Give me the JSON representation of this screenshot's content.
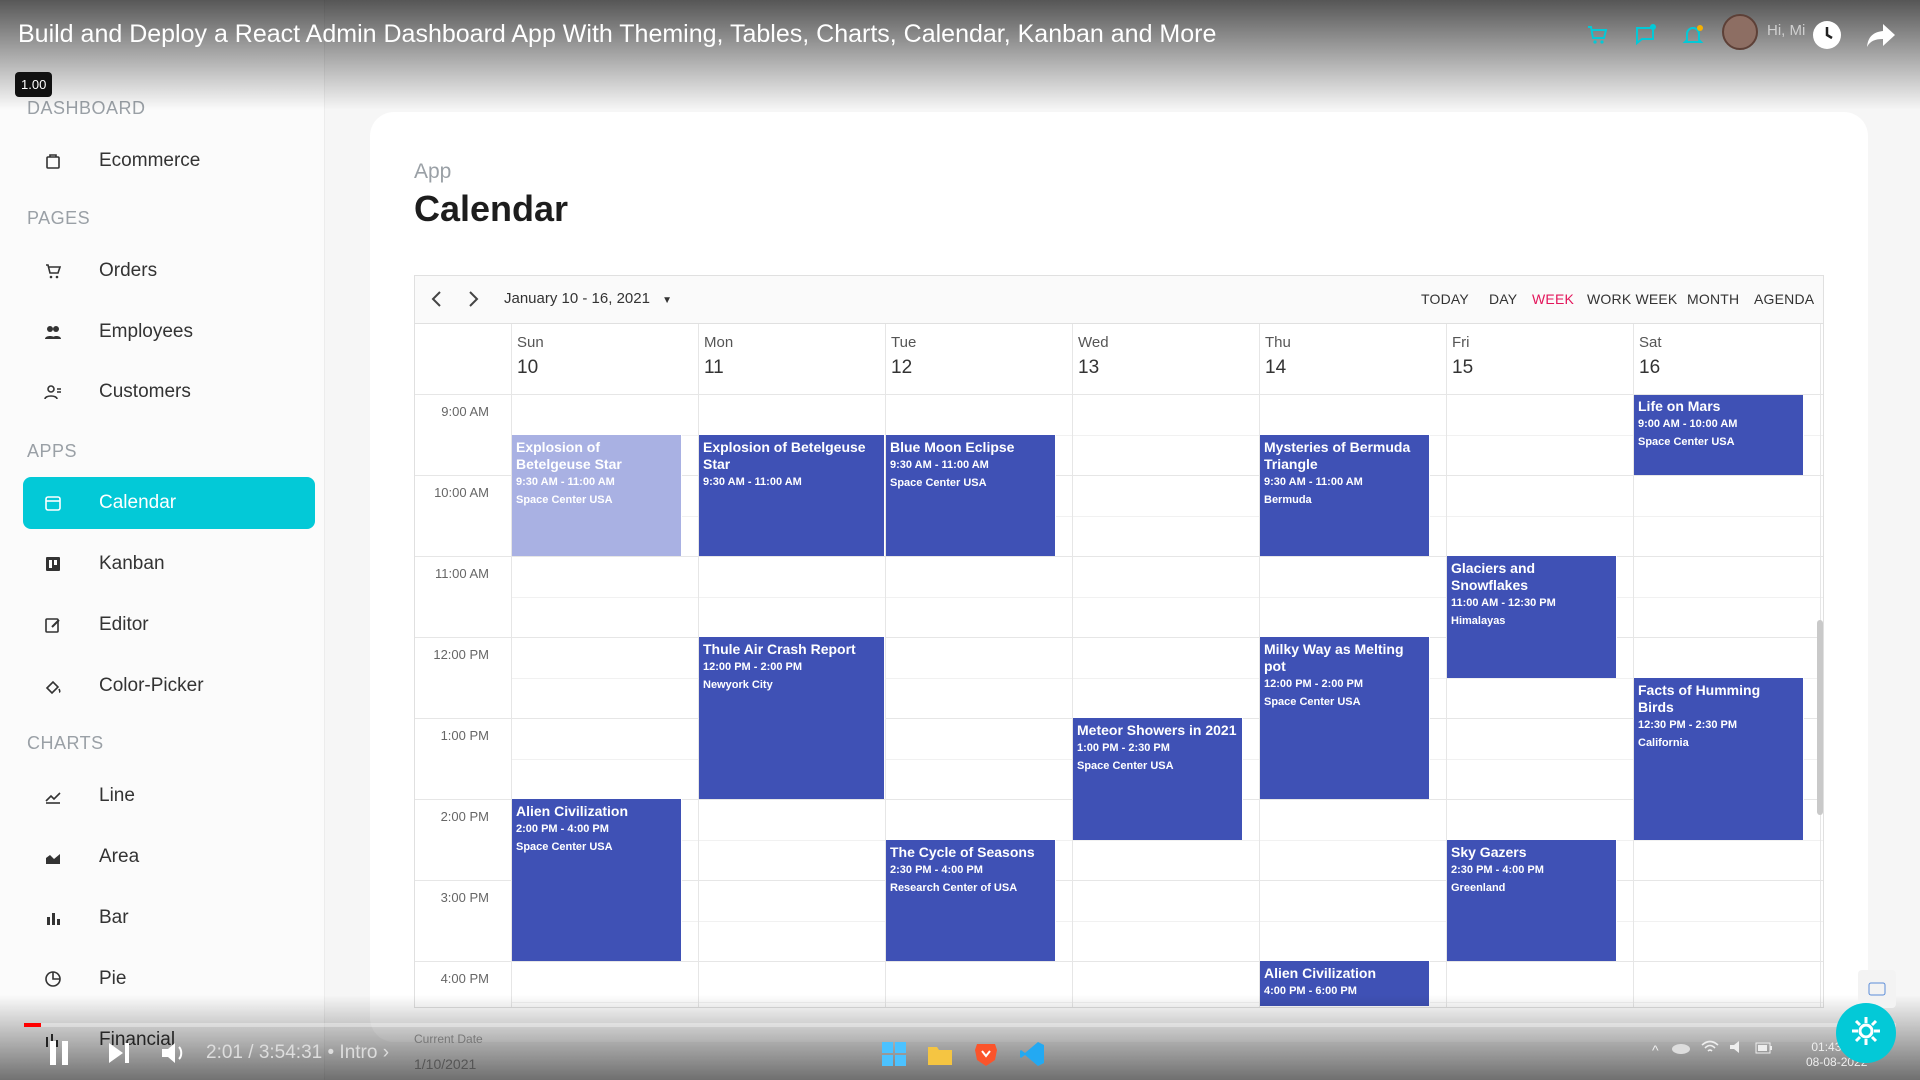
{
  "video": {
    "title": "Build and Deploy a React Admin Dashboard App With Theming, Tables, Charts, Calendar, Kanban and More",
    "speed": "1.00",
    "time": "2:01 / 3:54:31",
    "chapter": "• Intro ›",
    "progress_fraction": 0.009,
    "greeting": "Hi, Mi"
  },
  "sidebar": {
    "sections": [
      {
        "label": "DASHBOARD",
        "items": [
          {
            "label": "Ecommerce",
            "icon": "shopping-bag-icon"
          }
        ]
      },
      {
        "label": "PAGES",
        "items": [
          {
            "label": "Orders",
            "icon": "cart-icon"
          },
          {
            "label": "Employees",
            "icon": "employees-icon"
          },
          {
            "label": "Customers",
            "icon": "customers-icon"
          }
        ]
      },
      {
        "label": "APPS",
        "items": [
          {
            "label": "Calendar",
            "icon": "calendar-icon",
            "active": true
          },
          {
            "label": "Kanban",
            "icon": "kanban-icon"
          },
          {
            "label": "Editor",
            "icon": "editor-icon"
          },
          {
            "label": "Color-Picker",
            "icon": "color-picker-icon"
          }
        ]
      },
      {
        "label": "CHARTS",
        "items": [
          {
            "label": "Line",
            "icon": "line-chart-icon"
          },
          {
            "label": "Area",
            "icon": "area-chart-icon"
          },
          {
            "label": "Bar",
            "icon": "bar-chart-icon"
          },
          {
            "label": "Pie",
            "icon": "pie-chart-icon"
          },
          {
            "label": "Financial",
            "icon": "financial-icon"
          }
        ]
      }
    ],
    "accent": "#03c9d7"
  },
  "page": {
    "breadcrumb": "App",
    "title": "Calendar"
  },
  "scheduler": {
    "date_range": "January 10 - 16, 2021",
    "views": [
      "TODAY",
      "DAY",
      "WEEK",
      "WORK WEEK",
      "MONTH",
      "AGENDA"
    ],
    "selected_view": "WEEK",
    "days": [
      {
        "name": "Sun",
        "date": "10"
      },
      {
        "name": "Mon",
        "date": "11"
      },
      {
        "name": "Tue",
        "date": "12"
      },
      {
        "name": "Wed",
        "date": "13"
      },
      {
        "name": "Thu",
        "date": "14"
      },
      {
        "name": "Fri",
        "date": "15"
      },
      {
        "name": "Sat",
        "date": "16"
      }
    ],
    "times": [
      "9:00 AM",
      "10:00 AM",
      "11:00 AM",
      "12:00 PM",
      "1:00 PM",
      "2:00 PM",
      "3:00 PM",
      "4:00 PM"
    ],
    "events": [
      {
        "subject": "Explosion of Betelgeuse Star",
        "time": "9:30 AM - 11:00 AM",
        "location": "Space Center USA",
        "day": 0,
        "start": 9.5,
        "end": 11,
        "faded": true
      },
      {
        "subject": "Explosion of Betelgeuse Star",
        "time": "9:30 AM - 11:00 AM",
        "location": "",
        "day": 1,
        "start": 9.5,
        "end": 11
      },
      {
        "subject": "Blue Moon Eclipse",
        "time": "9:30 AM - 11:00 AM",
        "location": "Space Center USA",
        "day": 2,
        "start": 9.5,
        "end": 11
      },
      {
        "subject": "Mysteries of Bermuda Triangle",
        "time": "9:30 AM - 11:00 AM",
        "location": "Bermuda",
        "day": 4,
        "start": 9.5,
        "end": 11
      },
      {
        "subject": "Life on Mars",
        "time": "9:00 AM - 10:00 AM",
        "location": "Space Center USA",
        "day": 6,
        "start": 9,
        "end": 10
      },
      {
        "subject": "Glaciers and Snowflakes",
        "time": "11:00 AM - 12:30 PM",
        "location": "Himalayas",
        "day": 5,
        "start": 11,
        "end": 12.5
      },
      {
        "subject": "Thule Air Crash Report",
        "time": "12:00 PM - 2:00 PM",
        "location": "Newyork City",
        "day": 1,
        "start": 12,
        "end": 14
      },
      {
        "subject": "Milky Way as Melting pot",
        "time": "12:00 PM - 2:00 PM",
        "location": "Space Center USA",
        "day": 4,
        "start": 12,
        "end": 14
      },
      {
        "subject": "Facts of Humming Birds",
        "time": "12:30 PM - 2:30 PM",
        "location": "California",
        "day": 6,
        "start": 12.5,
        "end": 14.5
      },
      {
        "subject": "Meteor Showers in 2021",
        "time": "1:00 PM - 2:30 PM",
        "location": "Space Center USA",
        "day": 3,
        "start": 13,
        "end": 14.5
      },
      {
        "subject": "Alien Civilization",
        "time": "2:00 PM - 4:00 PM",
        "location": "Space Center USA",
        "day": 0,
        "start": 14,
        "end": 16
      },
      {
        "subject": "The Cycle of Seasons",
        "time": "2:30 PM - 4:00 PM",
        "location": "Research Center of USA",
        "day": 2,
        "start": 14.5,
        "end": 16
      },
      {
        "subject": "Sky Gazers",
        "time": "2:30 PM - 4:00 PM",
        "location": "Greenland",
        "day": 5,
        "start": 14.5,
        "end": 16
      },
      {
        "subject": "Alien Civilization",
        "time": "4:00 PM - 6:00 PM",
        "location": "",
        "day": 4,
        "start": 16,
        "end": 16.55
      }
    ],
    "event_color": "#3f51b5",
    "selected_color": "#e3165b"
  },
  "footer": {
    "current_date_label": "Current Date",
    "current_date": "1/10/2021"
  },
  "taskbar": {
    "time": "01:43 AM",
    "date": "08-08-2022"
  }
}
